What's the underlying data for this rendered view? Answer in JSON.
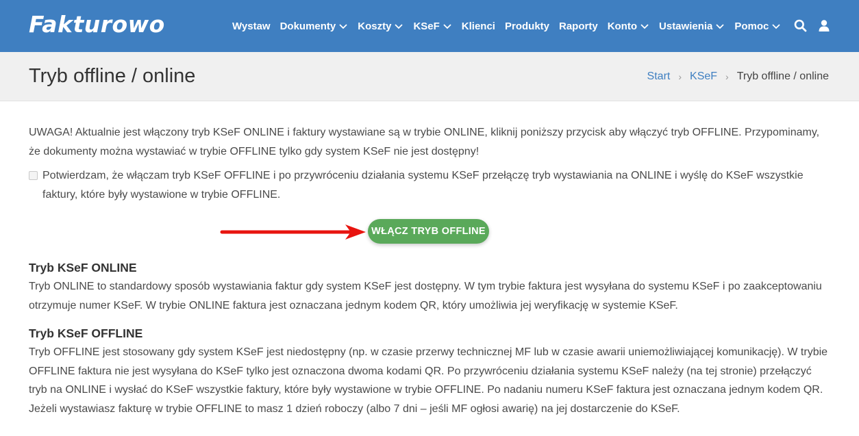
{
  "header": {
    "logo": "Fakturowo",
    "nav": [
      {
        "label": "Wystaw",
        "dropdown": false
      },
      {
        "label": "Dokumenty",
        "dropdown": true
      },
      {
        "label": "Koszty",
        "dropdown": true
      },
      {
        "label": "KSeF",
        "dropdown": true
      },
      {
        "label": "Klienci",
        "dropdown": false
      },
      {
        "label": "Produkty",
        "dropdown": false
      },
      {
        "label": "Raporty",
        "dropdown": false
      },
      {
        "label": "Konto",
        "dropdown": true
      },
      {
        "label": "Ustawienia",
        "dropdown": true
      },
      {
        "label": "Pomoc",
        "dropdown": true
      }
    ],
    "icons": [
      "search-icon",
      "user-icon"
    ],
    "colors": {
      "bar": "#3f7fc1",
      "text": "#ffffff"
    }
  },
  "titlebar": {
    "title": "Tryb offline / online",
    "breadcrumb": {
      "start": "Start",
      "ksef": "KSeF",
      "current": "Tryb offline / online"
    }
  },
  "main": {
    "notice": "UWAGA! Aktualnie jest włączony tryb KSeF ONLINE i faktury wystawiane są w trybie ONLINE, kliknij poniższy przycisk aby włączyć tryb OFFLINE. Przypominamy, że dokumenty można wystawiać w trybie OFFLINE tylko gdy system KSeF nie jest dostępny!",
    "confirm_checked": false,
    "confirm_label": "Potwierdzam, że włączam tryb KSeF OFFLINE i po przywróceniu działania systemu KSeF przełączę tryb wystawiania na ONLINE i wyślę do KSeF wszystkie faktury, które były wystawione w trybie OFFLINE.",
    "button_label": "WŁĄCZ TRYB OFFLINE",
    "button_color": "#5aa95a",
    "arrow_color": "#e8140f",
    "sections": [
      {
        "heading": "Tryb KSeF ONLINE",
        "text": "Tryb ONLINE to standardowy sposób wystawiania faktur gdy system KSeF jest dostępny. W tym trybie faktura jest wysyłana do systemu KSeF i po zaakceptowaniu otrzymuje numer KSeF. W trybie ONLINE faktura jest oznaczana jednym kodem QR, który umożliwia jej weryfikację w systemie KSeF."
      },
      {
        "heading": "Tryb KSeF OFFLINE",
        "text": "Tryb OFFLINE jest stosowany gdy system KSeF jest niedostępny (np. w czasie przerwy technicznej MF lub w czasie awarii uniemożliwiającej komunikację). W trybie OFFLINE faktura nie jest wysyłana do KSeF tylko jest oznaczona dwoma kodami QR. Po przywróceniu działania systemu KSeF należy (na tej stronie) przełączyć tryb na ONLINE i wysłać do KSeF wszystkie faktury, które były wystawione w trybie OFFLINE. Po nadaniu numeru KSeF faktura jest oznaczana jednym kodem QR. Jeżeli wystawiasz fakturę w trybie OFFLINE to masz 1 dzień roboczy (albo 7 dni – jeśli MF ogłosi awarię) na jej dostarczenie do KSeF."
      }
    ]
  }
}
